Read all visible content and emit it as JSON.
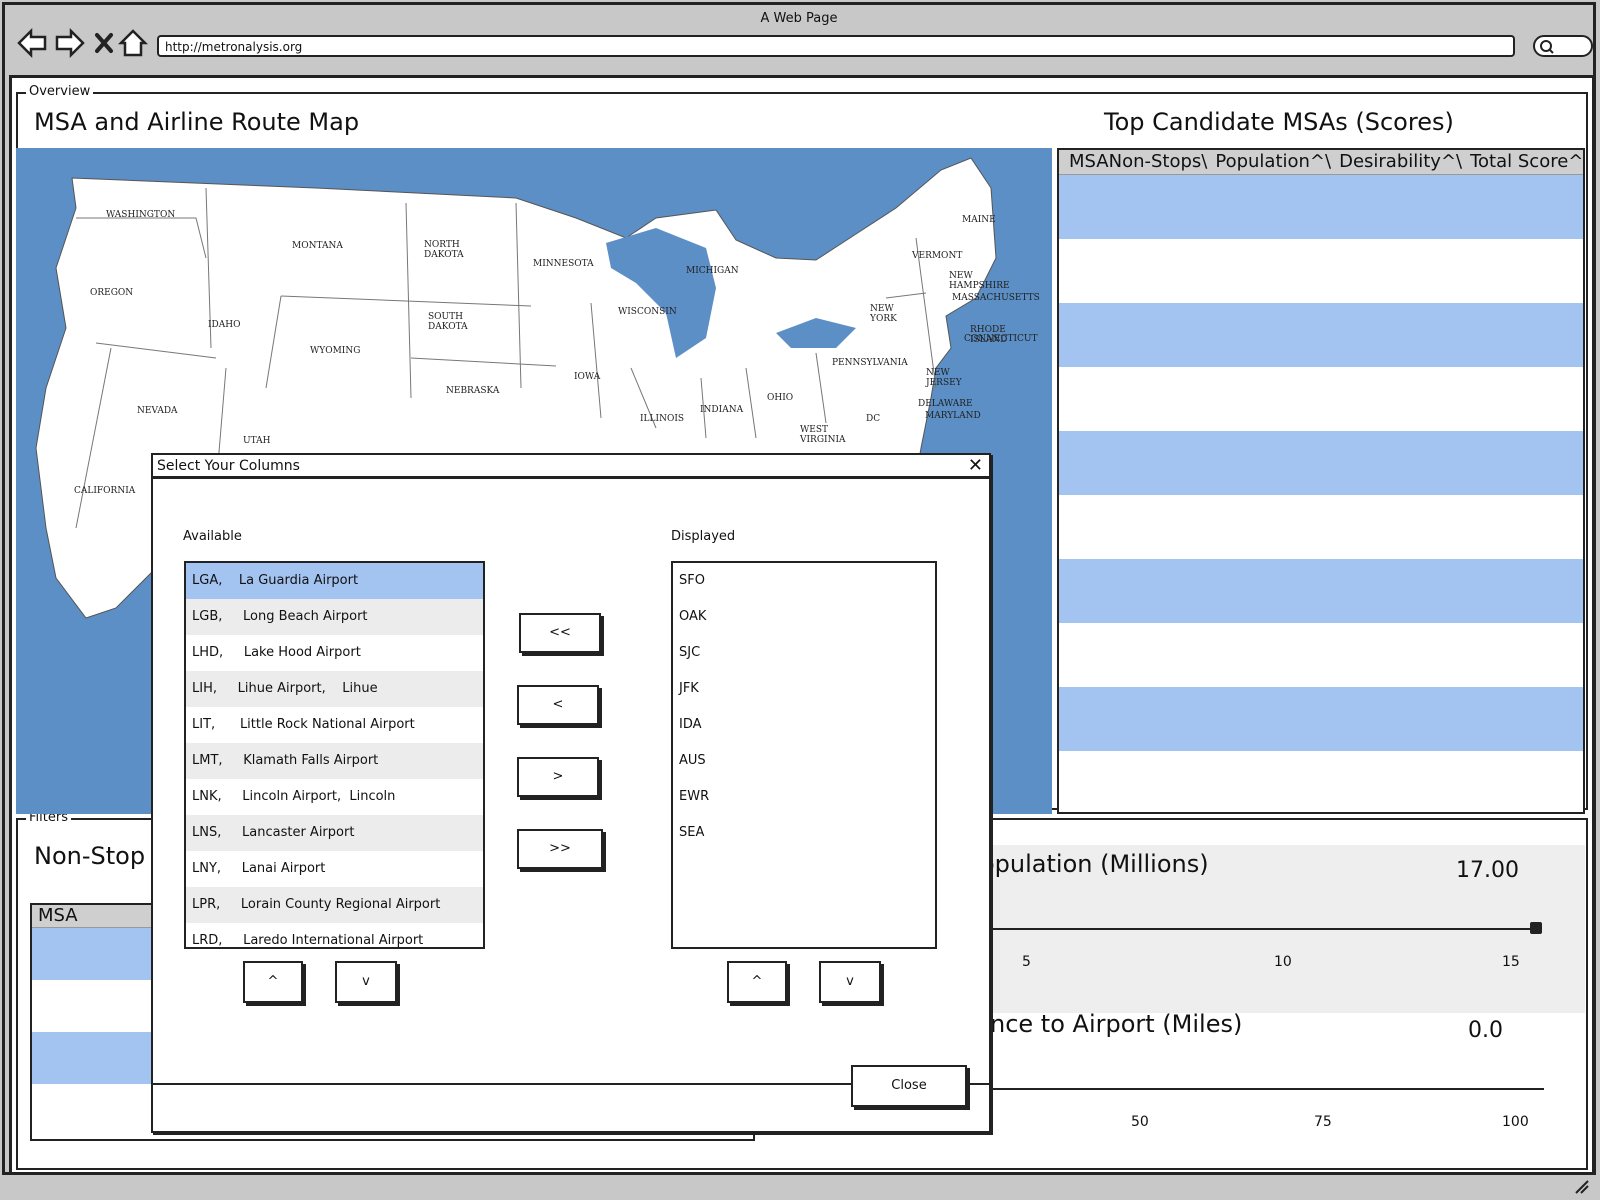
{
  "browser": {
    "title": "A Web Page",
    "url": "http://metronalysis.org"
  },
  "overview": {
    "legend": "Overview",
    "map_title": "MSA and Airline Route Map",
    "table_title": "Top Candidate MSAs (Scores)",
    "table_columns": [
      "MSA",
      "Non-Stops\\",
      "Population^\\",
      "Desirability^\\",
      "Total Score^v"
    ],
    "states": [
      "WASHINGTON",
      "MONTANA",
      "NORTH DAKOTA",
      "MINNESOTA",
      "MAINE",
      "OREGON",
      "IDAHO",
      "SOUTH DAKOTA",
      "WISCONSIN",
      "MICHIGAN",
      "VERMONT",
      "NEW HAMPSHIRE",
      "MASSACHUSETTS",
      "NEW YORK",
      "RHODE ISLAND",
      "CONNECTICUT",
      "WYOMING",
      "NEBRASKA",
      "IOWA",
      "PENNSYLVANIA",
      "NEW JERSEY",
      "NEVADA",
      "ILLINOIS",
      "INDIANA",
      "OHIO",
      "DELAWARE",
      "MARYLAND",
      "DC",
      "WEST VIRGINIA",
      "UTAH",
      "CALIFORNIA"
    ]
  },
  "filters": {
    "legend": "Filters",
    "nonstop_title": "Non-Stop D",
    "msa_col": "MSA",
    "population": {
      "title": "opulation (Millions)",
      "value": "17.00",
      "ticks": [
        "5",
        "10",
        "15"
      ]
    },
    "distance": {
      "title": "nce to Airport (Miles)",
      "value": "0.0",
      "ticks": [
        "50",
        "75",
        "100"
      ]
    }
  },
  "modal": {
    "title": "Select Your Columns",
    "available_label": "Available",
    "displayed_label": "Displayed",
    "available": [
      "LGA,    La Guardia Airport",
      "LGB,     Long Beach Airport",
      "LHD,     Lake Hood Airport",
      "LIH,     Lihue Airport,    Lihue",
      "LIT,      Little Rock National Airport",
      "LMT,     Klamath Falls Airport",
      "LNK,     Lincoln Airport,  Lincoln",
      "LNS,     Lancaster Airport",
      "LNY,     Lanai Airport",
      "LPR,     Lorain County Regional Airport",
      "LRD,     Laredo International Airport"
    ],
    "displayed": [
      "SFO",
      "OAK",
      "SJC",
      "JFK",
      "IDA",
      "AUS",
      "EWR",
      "SEA"
    ],
    "move_all_left": "<<",
    "move_left": "<",
    "move_right": ">",
    "move_all_right": ">>",
    "up": "^",
    "down": "v",
    "close": "Close"
  },
  "colors": {
    "water": "#5b8fc6",
    "row_highlight": "#a3c3f1",
    "header_gray": "#cfcfcf"
  }
}
